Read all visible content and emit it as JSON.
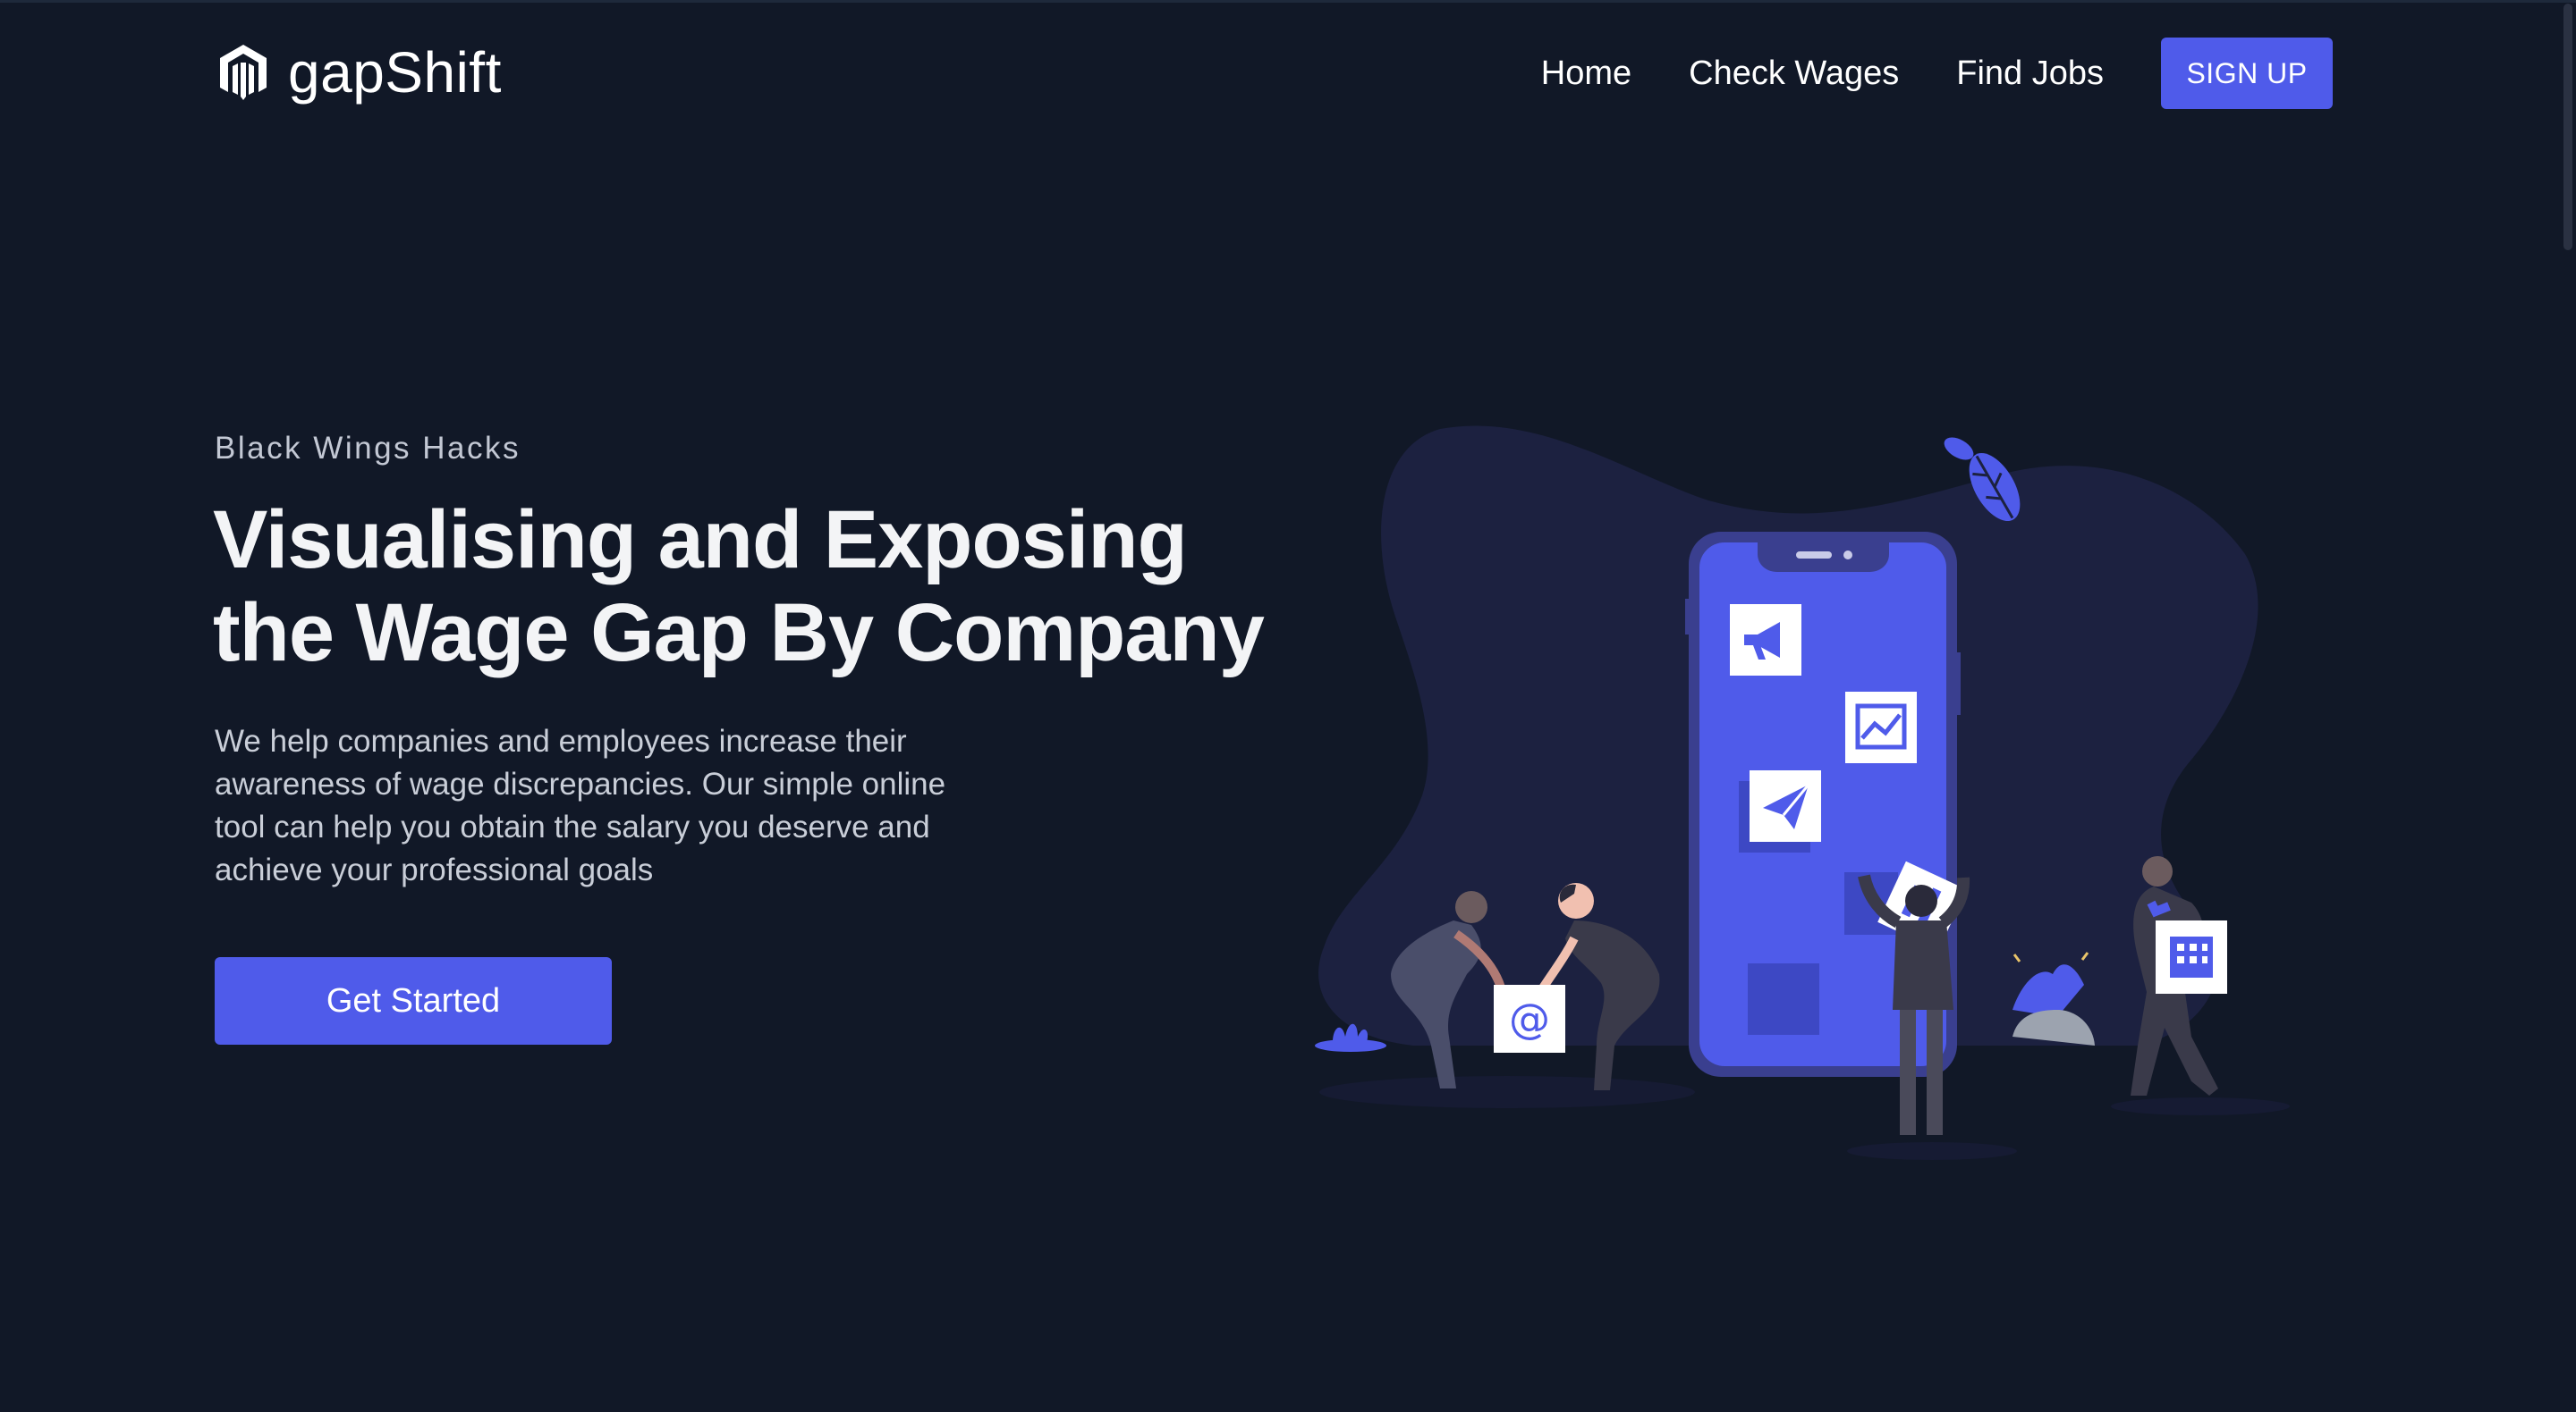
{
  "brand": {
    "name": "gapShift",
    "logo_icon": "hexagon-m-logo-icon"
  },
  "nav": {
    "links": [
      "Home",
      "Check Wages",
      "Find Jobs"
    ],
    "signup_label": "SIGN UP"
  },
  "hero": {
    "eyebrow": "Black Wings Hacks",
    "headline_line1": "Visualising and Exposing",
    "headline_line2": "the Wage Gap By Company",
    "description": "We help companies and employees increase their awareness of wage discrepancies. Our simple online tool can help you obtain the salary you deserve and achieve your professional goals",
    "cta_label": "Get Started"
  },
  "illustration": {
    "icons": [
      "megaphone-icon",
      "chart-icon",
      "paper-plane-icon",
      "at-sign-icon",
      "building-icon",
      "leaf-icon"
    ],
    "at_symbol": "@"
  },
  "colors": {
    "background": "#111827",
    "accent": "#4f5bea",
    "blob": "#1c2140"
  }
}
